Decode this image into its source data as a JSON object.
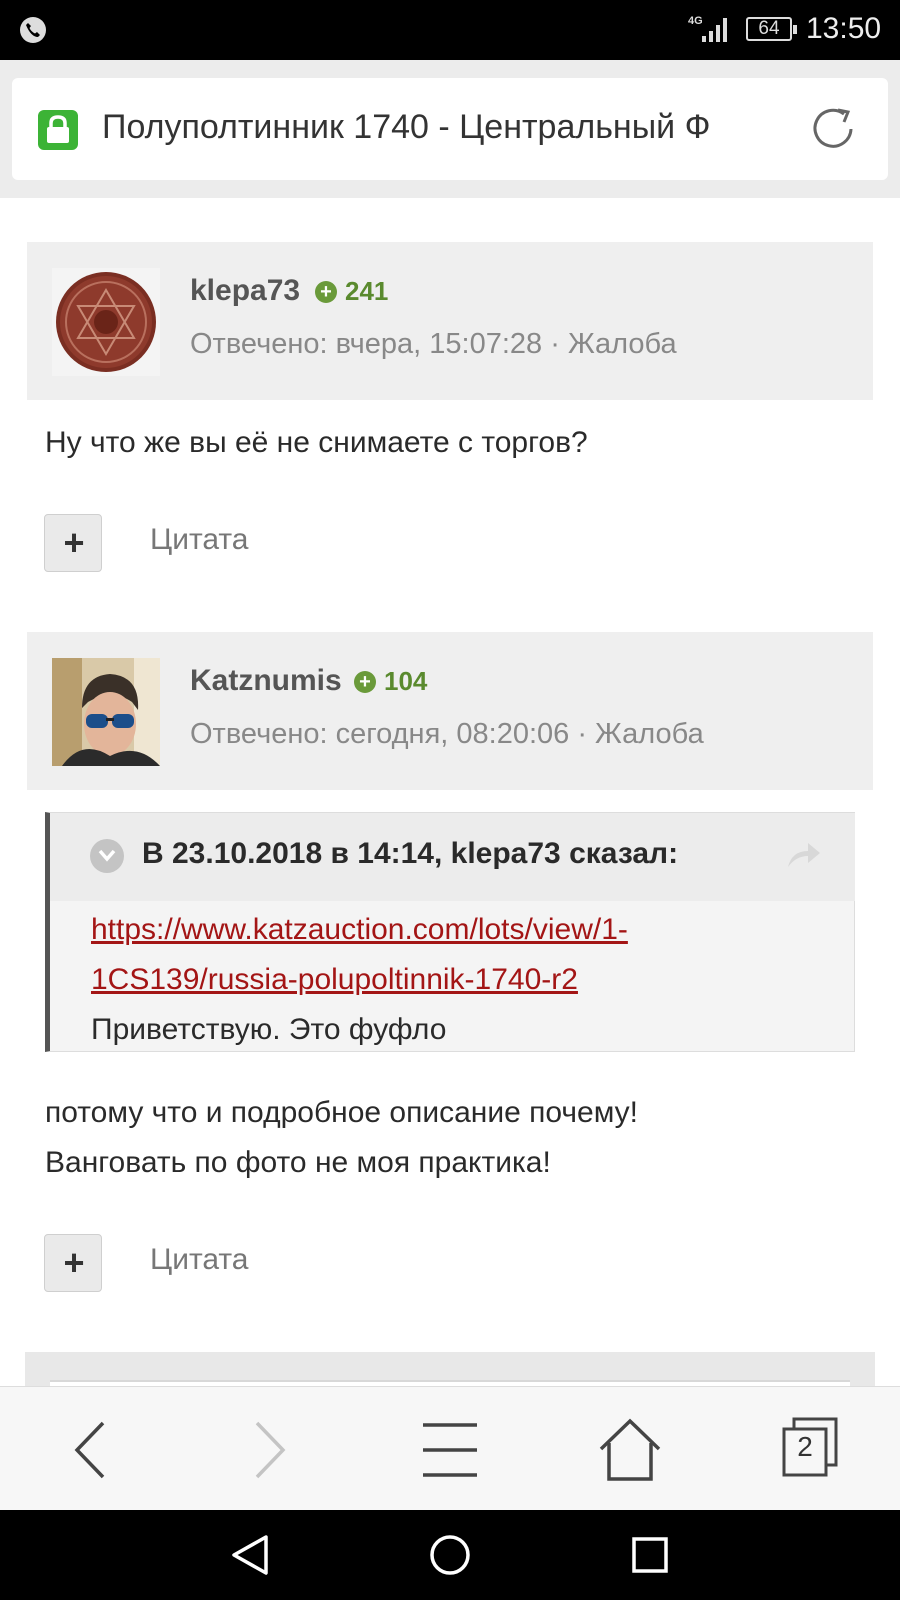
{
  "status_bar": {
    "network": "4G",
    "battery": "64",
    "time": "13:50"
  },
  "browser": {
    "page_title": "Полуполтинник 1740 - Центральный Ф",
    "tab_count": "2"
  },
  "posts": [
    {
      "username": "klepa73",
      "reputation": "241",
      "meta": "Отвечено: вчера, 15:07:28 · Жалоба",
      "body": "Ну что же вы её не снимаете с торгов?",
      "quote_label": "Цитата"
    },
    {
      "username": "Katznumis",
      "reputation": "104",
      "meta": "Отвечено: сегодня, 08:20:06 · Жалоба",
      "quote": {
        "citation": "В 23.10.2018 в 14:14, klepa73 сказал:",
        "link": "https://www.katzauction.com/lots/view/1-1CS139/russia-polupoltinnik-1740-r2",
        "text": "Приветствую. Это фуфло"
      },
      "body_lines": [
        "потому что и подробное описание почему!",
        "Ванговать по фото не моя практика!"
      ],
      "quote_label": "Цитата"
    }
  ],
  "colors": {
    "accent_green": "#3cb336",
    "link_red": "#a31515",
    "rep_green": "#5a8a2e"
  },
  "icons": {
    "status": [
      "phone-call-icon",
      "signal-icon",
      "battery-icon"
    ],
    "toolbar": [
      "back-icon",
      "forward-icon",
      "menu-icon",
      "home-icon",
      "tabs-icon"
    ],
    "nav": [
      "nav-back-icon",
      "nav-home-icon",
      "nav-recents-icon"
    ]
  }
}
